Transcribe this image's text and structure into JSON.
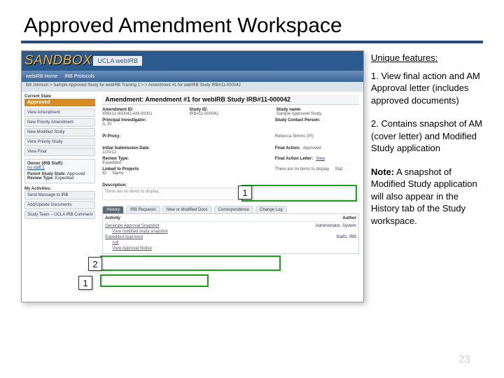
{
  "title": "Approved Amendment Workspace",
  "screenshot": {
    "sandbox": "SANDBOX",
    "uclaBox": "UCLA webIRB",
    "tabs": [
      "webIRB Home",
      "IRB Protocols"
    ],
    "crumbs": "Bill Johnson > Sample Approved Study for webIRB Training 1 > > Amendment #1 for webIRB Study IRB#11-000042",
    "left": {
      "stateLabel": "Current State",
      "stateValue": "Approved",
      "buttons": [
        "View Amendment",
        "New Priority Amendment",
        "New Modified Study",
        "View Priority Study",
        "View Final"
      ],
      "ownerLabel": "Owner (IRB Staff):",
      "owner": "no staff 1",
      "parentLabel": "Parent Study State:",
      "parentValue": "Approved",
      "reviewLabel": "Review Type:",
      "reviewValue": "Expedited",
      "activitiesLabel": "My Activities:",
      "activities": [
        "Send Message to IRB",
        "Add/Update Documents",
        "Study Team – UCLA IRB Comment"
      ]
    },
    "main": {
      "amendTitle": "Amendment: Amendment #1 for webIRB Study IRB#11-000042",
      "row1": [
        {
          "label": "Amendment ID:",
          "value": "IRB#11-000042-AM-00001"
        },
        {
          "label": "Study ID:",
          "value": "IRB#11-000042"
        },
        {
          "label": "Study name:",
          "value": "Sample Approved Study"
        }
      ],
      "row2": [
        {
          "label": "Principal Investigator:",
          "value": "A. PI"
        },
        {
          "label": "Study Contact Person:",
          "value": ""
        }
      ],
      "piProxyLabel": "PI Proxy:",
      "piProxyValue": "Rebecca Simms (PI)",
      "row3": [
        {
          "label": "Initial Submission Date:",
          "value": "1/20/12"
        },
        {
          "label": "Final Action:",
          "value": "Approved"
        }
      ],
      "row4": [
        {
          "label": "Review Type:",
          "value": "Expedited"
        },
        {
          "label": "Final Action Letter:",
          "value": "View"
        }
      ],
      "row5": [
        {
          "label": "Linked to Projects",
          "value": "ID     Name"
        },
        {
          "label": "",
          "value": "There are no items to display     Stat"
        }
      ],
      "descLabel": "Description:",
      "descText": "There are no items to display.",
      "innertabs": [
        "History",
        "IRB Requests",
        "New or Modified Docs",
        "Correspondence",
        "Change Log"
      ],
      "history": {
        "headers": [
          "Activity",
          "Author"
        ],
        "rows": [
          {
            "act": "Generate Approval Snapshot",
            "auth": "Administrator, System"
          },
          {
            "act": "View modified study snapshot",
            "auth": ""
          },
          {
            "act": "Expedited Approved",
            "auth": "Staff1, IRB"
          },
          {
            "act": "null",
            "auth": ""
          },
          {
            "act": "View Approval Notice",
            "auth": ""
          }
        ]
      }
    }
  },
  "notes": {
    "header": "Unique features:",
    "item1": "1. View final action and AM Approval letter (includes approved documents)",
    "item2": "2. Contains snapshot of AM (cover letter) and Modified Study application",
    "noteBold": "Note:",
    "noteRest": " A snapshot of Modified Study application will also appear in the History tab of the Study workspace."
  },
  "calloutNumbers": {
    "a": "1",
    "b": "2",
    "c": "1"
  },
  "pageNumber": "23"
}
